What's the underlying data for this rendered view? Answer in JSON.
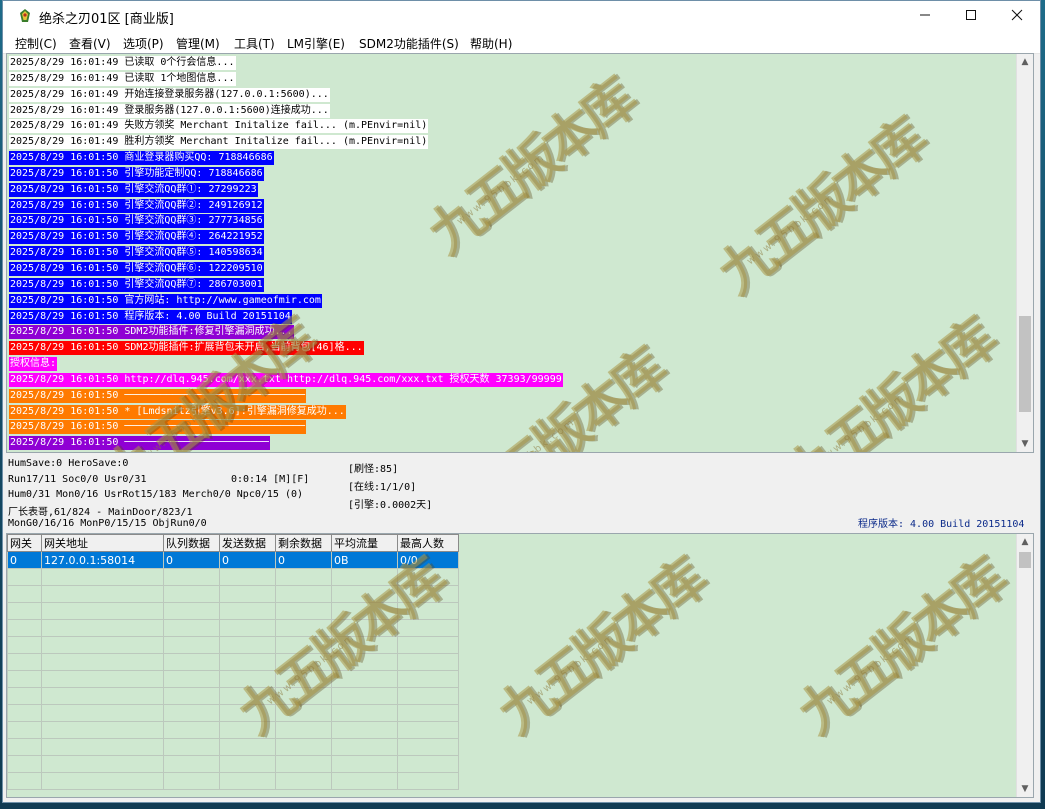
{
  "window": {
    "title": "绝杀之刃01区 [商业版]"
  },
  "menu": [
    "控制(C)",
    "查看(V)",
    "选项(P)",
    "管理(M)",
    "工具(T)",
    "LM引擎(E)",
    "SDM2功能插件(S)",
    "帮助(H)"
  ],
  "log": [
    {
      "text": "2025/8/29 16:01:49 已读取 0个行会信息...",
      "color": "white"
    },
    {
      "text": "2025/8/29 16:01:49 已读取 1个地图信息...",
      "color": "white"
    },
    {
      "text": "2025/8/29 16:01:49 开始连接登录服务器(127.0.0.1:5600)...",
      "color": "white"
    },
    {
      "text": "2025/8/29 16:01:49 登录服务器(127.0.0.1:5600)连接成功...",
      "color": "white"
    },
    {
      "text": "2025/8/29 16:01:49 失败方领奖 Merchant Initalize fail... (m.PEnvir=nil)",
      "color": "white"
    },
    {
      "text": "2025/8/29 16:01:49 胜利方领奖 Merchant Initalize fail... (m.PEnvir=nil)",
      "color": "white"
    },
    {
      "text": "2025/8/29 16:01:50 商业登录器购买QQ: 718846686",
      "color": "blue"
    },
    {
      "text": "2025/8/29 16:01:50 引擎功能定制QQ: 718846686",
      "color": "blue"
    },
    {
      "text": "2025/8/29 16:01:50 引擎交流QQ群①: 27299223",
      "color": "blue"
    },
    {
      "text": "2025/8/29 16:01:50 引擎交流QQ群②: 249126912",
      "color": "blue"
    },
    {
      "text": "2025/8/29 16:01:50 引擎交流QQ群③: 277734856",
      "color": "blue"
    },
    {
      "text": "2025/8/29 16:01:50 引擎交流QQ群④: 264221952",
      "color": "blue"
    },
    {
      "text": "2025/8/29 16:01:50 引擎交流QQ群⑤: 140598634",
      "color": "blue"
    },
    {
      "text": "2025/8/29 16:01:50 引擎交流QQ群⑥: 122209510",
      "color": "blue"
    },
    {
      "text": "2025/8/29 16:01:50 引擎交流QQ群⑦: 286703001",
      "color": "blue"
    },
    {
      "text": "2025/8/29 16:01:50 官方网站: http://www.gameofmir.com",
      "color": "blue"
    },
    {
      "text": "2025/8/29 16:01:50 程序版本: 4.00 Build 20151104",
      "color": "blue"
    },
    {
      "text": "2025/8/29 16:01:50 SDM2功能插件:修复引擎漏洞成功...",
      "color": "purple"
    },
    {
      "text": "2025/8/29 16:01:50 SDM2功能插件:扩展背包未开启,当前背包[46]格...",
      "color": "red"
    },
    {
      "text": "授权信息:",
      "color": "magenta"
    },
    {
      "text": "2025/8/29 16:01:50 http://dlq.945.com/xxx.txt http://dlq.945.com/xxx.txt 授权天数 37393/99999",
      "color": "magenta"
    },
    {
      "text": "2025/8/29 16:01:50 ──────────────────────────────",
      "color": "orange"
    },
    {
      "text": "2025/8/29 16:01:50 * [Lmdsnitz引擎v3.6]:引擎漏洞修复成功...",
      "color": "orange"
    },
    {
      "text": "2025/8/29 16:01:50 ──────────────────────────────",
      "color": "orange"
    },
    {
      "text": "2025/8/29 16:01:50 ────────────────────────",
      "color": "purple"
    }
  ],
  "status": {
    "line1": "HumSave:0 HeroSave:0",
    "line2": "Run17/11 Soc0/0 Usr0/31",
    "line2b": "0:0:14 [M][F]",
    "line3": "Hum0/31 Mon0/16 UsrRot15/183 Merch0/0 Npc0/15 (0)",
    "line4": "厂长表哥,61/824 - MainDoor/823/1",
    "line5": "MonG0/16/16 MonP0/15/15 ObjRun0/0",
    "right1": "[刷怪:85]",
    "right2": "[在线:1/1/0]",
    "right3": "[引擎:0.0002天]",
    "version": "程序版本: 4.00 Build 20151104"
  },
  "grid": {
    "headers": [
      "网关",
      "网关地址",
      "队列数据",
      "发送数据",
      "剩余数据",
      "平均流量",
      "最高人数"
    ],
    "rows": [
      [
        "0",
        "127.0.0.1:58014",
        "0",
        "0",
        "0",
        "0B",
        "0/0"
      ]
    ]
  },
  "watermark": {
    "main": "九五版本库",
    "sub": "www.95bbk.com"
  },
  "colors": {
    "accent": "#0078d7",
    "log_bg": "#cfe8d0"
  }
}
